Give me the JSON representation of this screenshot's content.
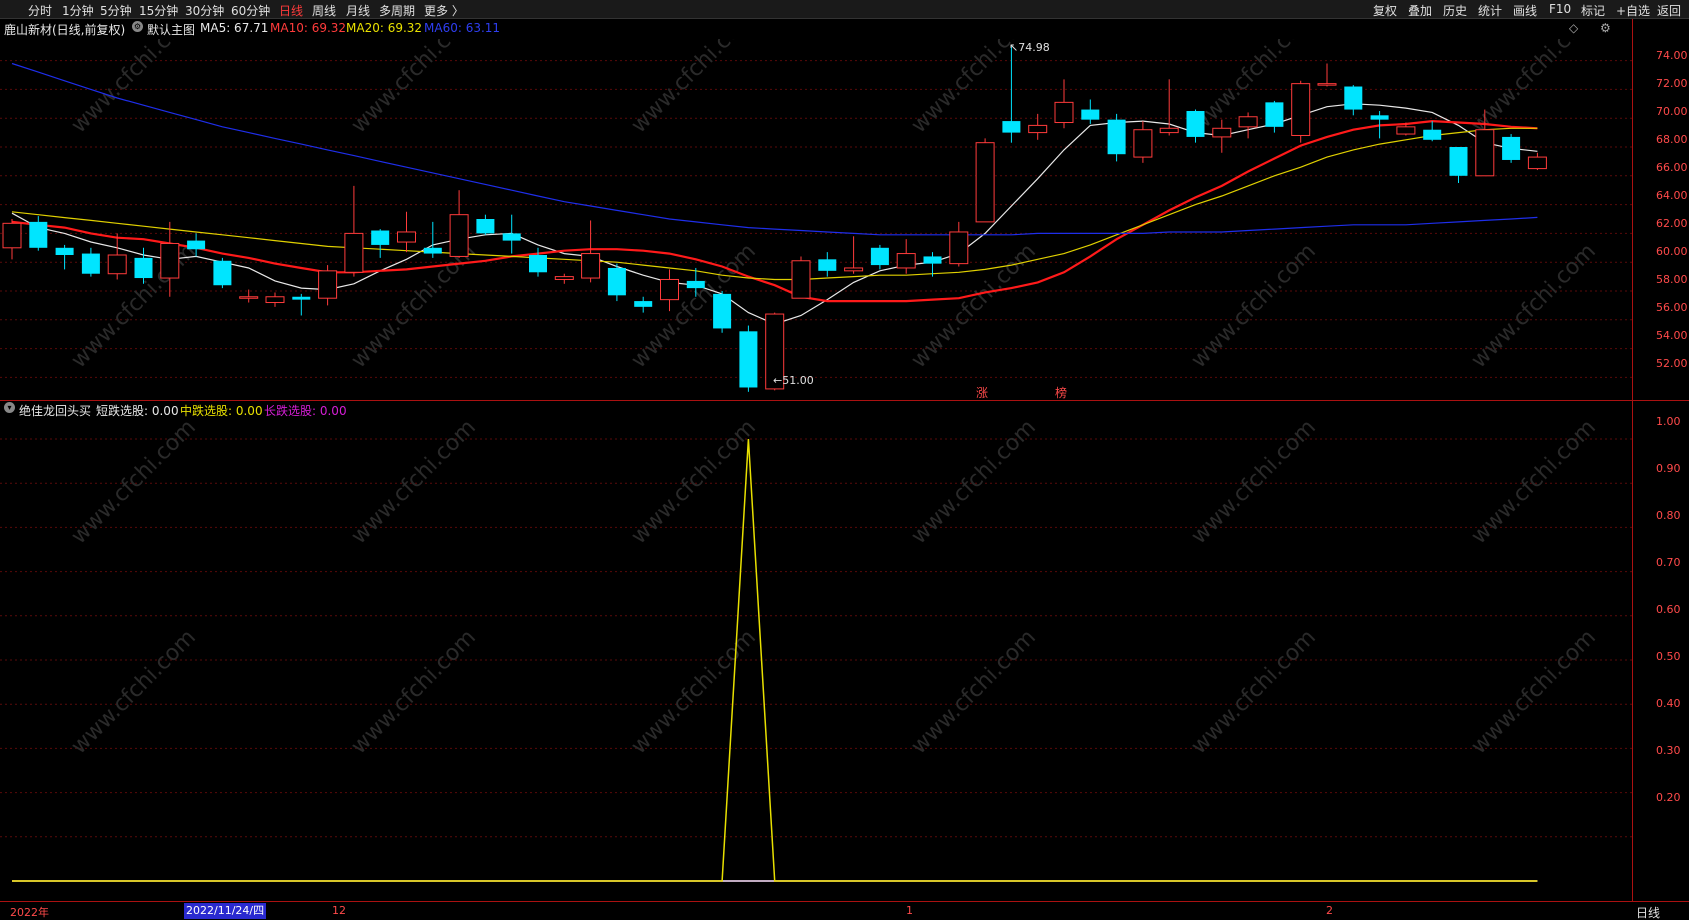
{
  "toolbar": {
    "tabs": [
      "分时",
      "1分钟",
      "5分钟",
      "15分钟",
      "30分钟",
      "60分钟",
      "日线",
      "周线",
      "月线",
      "多周期",
      "更多 〉"
    ],
    "active_tab": "日线",
    "right_tabs": [
      "复权",
      "叠加",
      "历史",
      "统计",
      "画线",
      "F10",
      "标记",
      "+自选",
      "返回"
    ]
  },
  "main_info": {
    "stock_name": "鹿山新材",
    "period_desc": "(日线,前复权)",
    "template": "默认主图",
    "ma5_label": "MA5: 67.71",
    "ma10_label": "MA10: 69.32",
    "ma20_label": "MA20: 69.32",
    "ma60_label": "MA60: 63.11",
    "icons": [
      "diamond-icon",
      "gear-icon"
    ]
  },
  "sub_info": {
    "indicator_name": "绝佳龙回头买",
    "short_label": "短跌选股: 0.00",
    "mid_label": "中跌选股: 0.00",
    "long_label": "长跌选股: 0.00"
  },
  "annotations": {
    "high": "74.98",
    "low": "51.00",
    "tag_zhang": "涨",
    "tag_bang": "榜"
  },
  "main_axis": [
    "74.00",
    "72.00",
    "70.00",
    "68.00",
    "66.00",
    "64.00",
    "62.00",
    "60.00",
    "58.00",
    "56.00",
    "54.00",
    "52.00"
  ],
  "sub_axis": [
    "1.00",
    "0.90",
    "0.80",
    "0.70",
    "0.60",
    "0.50",
    "0.40",
    "0.30",
    "0.20"
  ],
  "date_bar": {
    "year_label": "2022年",
    "selected_date": "2022/11/24/四",
    "ticks": [
      "12",
      "1",
      "2"
    ],
    "period": "日线"
  },
  "watermark": "www.cfchi.com",
  "colors": {
    "up": "#ff3b3b",
    "down": "#00e5ff",
    "ma5": "#e8e8e8",
    "ma10": "#ff1a1a",
    "ma20": "#e0d000",
    "ma60": "#1e2eea",
    "short": "#e0e0e0",
    "mid": "#e8e000",
    "long": "#d61ed6"
  },
  "chart_data": [
    {
      "type": "candlestick",
      "title": "鹿山新材 (日线,前复权)",
      "ylim": [
        50.5,
        75.5
      ],
      "candles": [
        {
          "o": 61.0,
          "c": 62.7,
          "h": 63.0,
          "l": 60.2
        },
        {
          "o": 62.8,
          "c": 61.0,
          "h": 63.2,
          "l": 60.8
        },
        {
          "o": 61.0,
          "c": 60.5,
          "h": 61.2,
          "l": 59.5
        },
        {
          "o": 60.6,
          "c": 59.2,
          "h": 61.0,
          "l": 59.0
        },
        {
          "o": 59.2,
          "c": 60.5,
          "h": 62.0,
          "l": 58.8
        },
        {
          "o": 60.3,
          "c": 58.9,
          "h": 61.0,
          "l": 58.5
        },
        {
          "o": 58.9,
          "c": 61.3,
          "h": 62.8,
          "l": 57.6
        },
        {
          "o": 61.5,
          "c": 60.9,
          "h": 62.0,
          "l": 60.4
        },
        {
          "o": 60.1,
          "c": 58.4,
          "h": 60.3,
          "l": 58.2
        },
        {
          "o": 57.5,
          "c": 57.6,
          "h": 58.1,
          "l": 57.2
        },
        {
          "o": 57.2,
          "c": 57.6,
          "h": 57.9,
          "l": 56.9
        },
        {
          "o": 57.6,
          "c": 57.4,
          "h": 57.8,
          "l": 56.3
        },
        {
          "o": 57.5,
          "c": 59.4,
          "h": 59.8,
          "l": 57.0
        },
        {
          "o": 59.3,
          "c": 62.0,
          "h": 65.3,
          "l": 59.0
        },
        {
          "o": 62.2,
          "c": 61.2,
          "h": 62.3,
          "l": 60.3
        },
        {
          "o": 61.4,
          "c": 62.1,
          "h": 63.5,
          "l": 60.7
        },
        {
          "o": 61.0,
          "c": 60.6,
          "h": 62.8,
          "l": 60.3
        },
        {
          "o": 60.4,
          "c": 63.3,
          "h": 65.0,
          "l": 60.3
        },
        {
          "o": 63.0,
          "c": 62.0,
          "h": 63.3,
          "l": 61.9
        },
        {
          "o": 62.0,
          "c": 61.5,
          "h": 63.3,
          "l": 60.6
        },
        {
          "o": 60.5,
          "c": 59.3,
          "h": 61.0,
          "l": 59.0
        },
        {
          "o": 58.8,
          "c": 59.0,
          "h": 59.2,
          "l": 58.5
        },
        {
          "o": 58.9,
          "c": 60.6,
          "h": 62.9,
          "l": 58.6
        },
        {
          "o": 59.6,
          "c": 57.7,
          "h": 59.9,
          "l": 57.3
        },
        {
          "o": 57.3,
          "c": 56.9,
          "h": 57.6,
          "l": 56.5
        },
        {
          "o": 57.4,
          "c": 58.8,
          "h": 59.5,
          "l": 56.6
        },
        {
          "o": 58.7,
          "c": 58.2,
          "h": 59.6,
          "l": 57.6
        },
        {
          "o": 57.8,
          "c": 55.4,
          "h": 58.0,
          "l": 55.1
        },
        {
          "o": 55.2,
          "c": 51.3,
          "h": 55.6,
          "l": 51.0
        },
        {
          "o": 51.2,
          "c": 56.4,
          "h": 56.5,
          "l": 51.1
        },
        {
          "o": 57.5,
          "c": 60.1,
          "h": 60.4,
          "l": 57.5
        },
        {
          "o": 60.2,
          "c": 59.4,
          "h": 60.7,
          "l": 59.0
        },
        {
          "o": 59.4,
          "c": 59.6,
          "h": 61.8,
          "l": 59.2
        },
        {
          "o": 61.0,
          "c": 59.8,
          "h": 61.2,
          "l": 59.5
        },
        {
          "o": 59.6,
          "c": 60.6,
          "h": 61.6,
          "l": 59.2
        },
        {
          "o": 60.4,
          "c": 59.9,
          "h": 60.7,
          "l": 59.0
        },
        {
          "o": 59.9,
          "c": 62.1,
          "h": 62.8,
          "l": 59.7
        },
        {
          "o": 62.8,
          "c": 68.3,
          "h": 68.6,
          "l": 62.8
        },
        {
          "o": 69.8,
          "c": 69.0,
          "h": 74.98,
          "l": 68.3
        },
        {
          "o": 69.0,
          "c": 69.5,
          "h": 70.3,
          "l": 68.5
        },
        {
          "o": 69.7,
          "c": 71.1,
          "h": 72.7,
          "l": 69.3
        },
        {
          "o": 70.6,
          "c": 69.9,
          "h": 71.3,
          "l": 69.6
        },
        {
          "o": 69.9,
          "c": 67.5,
          "h": 70.3,
          "l": 67.0
        },
        {
          "o": 67.3,
          "c": 69.2,
          "h": 69.8,
          "l": 66.9
        },
        {
          "o": 69.0,
          "c": 69.3,
          "h": 72.7,
          "l": 68.8
        },
        {
          "o": 70.5,
          "c": 68.7,
          "h": 70.6,
          "l": 68.3
        },
        {
          "o": 68.7,
          "c": 69.3,
          "h": 69.9,
          "l": 67.6
        },
        {
          "o": 69.4,
          "c": 70.1,
          "h": 70.4,
          "l": 68.6
        },
        {
          "o": 71.1,
          "c": 69.4,
          "h": 71.2,
          "l": 69.0
        },
        {
          "o": 68.8,
          "c": 72.4,
          "h": 72.6,
          "l": 68.3
        },
        {
          "o": 72.4,
          "c": 72.4,
          "h": 73.8,
          "l": 72.2
        },
        {
          "o": 72.2,
          "c": 70.6,
          "h": 72.3,
          "l": 70.2
        },
        {
          "o": 70.2,
          "c": 69.9,
          "h": 70.5,
          "l": 68.6
        },
        {
          "o": 68.9,
          "c": 69.4,
          "h": 69.7,
          "l": 68.8
        },
        {
          "o": 69.2,
          "c": 68.5,
          "h": 69.8,
          "l": 68.4
        },
        {
          "o": 68.0,
          "c": 66.0,
          "h": 68.0,
          "l": 65.5
        },
        {
          "o": 66.0,
          "c": 69.2,
          "h": 70.6,
          "l": 66.0
        },
        {
          "o": 68.7,
          "c": 67.1,
          "h": 68.9,
          "l": 66.9
        },
        {
          "o": 66.5,
          "c": 67.3,
          "h": 67.6,
          "l": 66.4
        }
      ],
      "series": [
        {
          "name": "MA5",
          "values": [
            63.4,
            62.4,
            62.0,
            61.4,
            61.0,
            60.5,
            60.2,
            60.4,
            60.0,
            59.6,
            58.7,
            58.2,
            58.1,
            58.5,
            59.4,
            60.2,
            61.2,
            61.6,
            61.9,
            62.0,
            61.2,
            60.6,
            60.4,
            59.7,
            59.1,
            58.6,
            58.4,
            57.8,
            56.5,
            55.7,
            56.3,
            57.4,
            58.6,
            59.4,
            59.8,
            60.0,
            60.6,
            62.0,
            63.9,
            65.8,
            67.8,
            69.5,
            69.7,
            69.8,
            69.6,
            69.0,
            68.8,
            69.2,
            69.6,
            70.2,
            70.8,
            71.0,
            70.9,
            70.7,
            70.4,
            69.5,
            68.3,
            67.9,
            67.7
          ]
        },
        {
          "name": "MA10",
          "values": [
            62.8,
            62.6,
            62.4,
            62.0,
            61.7,
            61.6,
            61.3,
            61.0,
            60.6,
            60.3,
            59.9,
            59.6,
            59.3,
            59.3,
            59.4,
            59.5,
            59.7,
            59.9,
            60.1,
            60.4,
            60.6,
            60.8,
            60.9,
            60.9,
            60.8,
            60.6,
            60.2,
            59.7,
            59.0,
            58.4,
            57.6,
            57.3,
            57.3,
            57.3,
            57.3,
            57.4,
            57.5,
            57.9,
            58.2,
            58.6,
            59.3,
            60.4,
            61.6,
            62.6,
            63.6,
            64.5,
            65.3,
            66.3,
            67.2,
            68.1,
            68.7,
            69.2,
            69.5,
            69.6,
            69.8,
            69.7,
            69.6,
            69.4,
            69.3
          ]
        },
        {
          "name": "MA20",
          "values": [
            63.5,
            63.3,
            63.1,
            62.9,
            62.7,
            62.5,
            62.3,
            62.1,
            61.9,
            61.7,
            61.5,
            61.3,
            61.1,
            61.0,
            60.9,
            60.8,
            60.7,
            60.6,
            60.5,
            60.4,
            60.3,
            60.2,
            60.1,
            60.0,
            59.8,
            59.6,
            59.4,
            59.1,
            58.9,
            58.8,
            58.8,
            58.9,
            59.0,
            59.1,
            59.1,
            59.2,
            59.3,
            59.5,
            59.8,
            60.2,
            60.6,
            61.2,
            61.9,
            62.6,
            63.3,
            64.0,
            64.6,
            65.3,
            66.0,
            66.6,
            67.3,
            67.8,
            68.2,
            68.5,
            68.8,
            69.0,
            69.2,
            69.3,
            69.3
          ]
        },
        {
          "name": "MA60",
          "values": [
            73.8,
            73.2,
            72.6,
            72.0,
            71.4,
            70.9,
            70.4,
            69.9,
            69.4,
            69.0,
            68.6,
            68.2,
            67.8,
            67.4,
            67.0,
            66.6,
            66.2,
            65.8,
            65.4,
            65.0,
            64.6,
            64.2,
            63.9,
            63.6,
            63.3,
            63.0,
            62.8,
            62.6,
            62.4,
            62.3,
            62.2,
            62.1,
            62.0,
            61.9,
            61.9,
            61.9,
            61.9,
            61.9,
            61.9,
            62.0,
            62.0,
            62.0,
            62.0,
            62.0,
            62.1,
            62.1,
            62.1,
            62.2,
            62.3,
            62.4,
            62.5,
            62.6,
            62.6,
            62.6,
            62.7,
            62.8,
            62.9,
            63.0,
            63.11
          ]
        }
      ]
    },
    {
      "type": "line",
      "title": "绝佳龙回头买",
      "ylim": [
        0,
        1.05
      ],
      "series": [
        {
          "name": "短跌选股",
          "values": [
            0,
            0,
            0,
            0,
            0,
            0,
            0,
            0,
            0,
            0,
            0,
            0,
            0,
            0,
            0,
            0,
            0,
            0,
            0,
            0,
            0,
            0,
            0,
            0,
            0,
            0,
            0,
            0,
            0,
            0,
            0,
            0,
            0,
            0,
            0,
            0,
            0,
            0,
            0,
            0,
            0,
            0,
            0,
            0,
            0,
            0,
            0,
            0,
            0,
            0,
            0,
            0,
            0,
            0,
            0,
            0,
            0,
            0,
            0
          ]
        },
        {
          "name": "中跌选股",
          "values": [
            0,
            0,
            0,
            0,
            0,
            0,
            0,
            0,
            0,
            0,
            0,
            0,
            0,
            0,
            0,
            0,
            0,
            0,
            0,
            0,
            0,
            0,
            0,
            0,
            0,
            0,
            0,
            0,
            1,
            0,
            0,
            0,
            0,
            0,
            0,
            0,
            0,
            0,
            0,
            0,
            0,
            0,
            0,
            0,
            0,
            0,
            0,
            0,
            0,
            0,
            0,
            0,
            0,
            0,
            0,
            0,
            0,
            0,
            0
          ]
        },
        {
          "name": "长跌选股",
          "values": [
            0,
            0,
            0,
            0,
            0,
            0,
            0,
            0,
            0,
            0,
            0,
            0,
            0,
            0,
            0,
            0,
            0,
            0,
            0,
            0,
            0,
            0,
            0,
            0,
            0,
            0,
            0,
            0,
            0,
            0,
            0,
            0,
            0,
            0,
            0,
            0,
            0,
            0,
            0,
            0,
            0,
            0,
            0,
            0,
            0,
            0,
            0,
            0,
            0,
            0,
            0,
            0,
            0,
            0,
            0,
            0,
            0,
            0,
            0
          ]
        }
      ]
    }
  ]
}
